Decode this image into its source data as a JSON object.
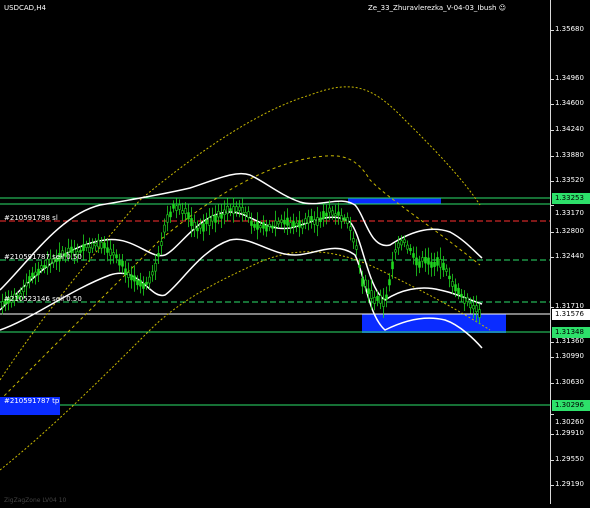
{
  "chart": {
    "symbol": "USDCAD,H4",
    "ea_name": "Ze_33_Zhuravlerezka_V-04-03_Ibush",
    "indicator_label": "ZigZagZone LV04 10"
  },
  "price_axis": {
    "ticks": [
      "1.35680",
      "1.34960",
      "1.34600",
      "1.34240",
      "1.33880",
      "1.33520",
      "1.33170",
      "1.32800",
      "1.32440",
      "1.31710",
      "1.31360",
      "1.30990",
      "1.30630",
      "1.30260",
      "1.29910",
      "1.29550",
      "1.29190"
    ],
    "tags": [
      {
        "text": "1.33253",
        "color": "#2de06a"
      },
      {
        "text": "1.31576",
        "color": "#ffffff"
      },
      {
        "text": "1.31348",
        "color": "#2de06a"
      },
      {
        "text": "1.30296",
        "color": "#2de06a"
      }
    ]
  },
  "orders": [
    {
      "label": "#210591788 sl"
    },
    {
      "label": "#210591787 sell 0.50"
    },
    {
      "label": "#210523146 sell 0.50"
    },
    {
      "label": "#210591787 tp"
    }
  ],
  "colors": {
    "background": "#000000",
    "levels": "#2de06a",
    "zone": "#0a2cff",
    "sl_line": "#ff3030",
    "candles": "#1fd61f",
    "bands": "#ffffff",
    "ma_dotted": "#c8b800"
  }
}
